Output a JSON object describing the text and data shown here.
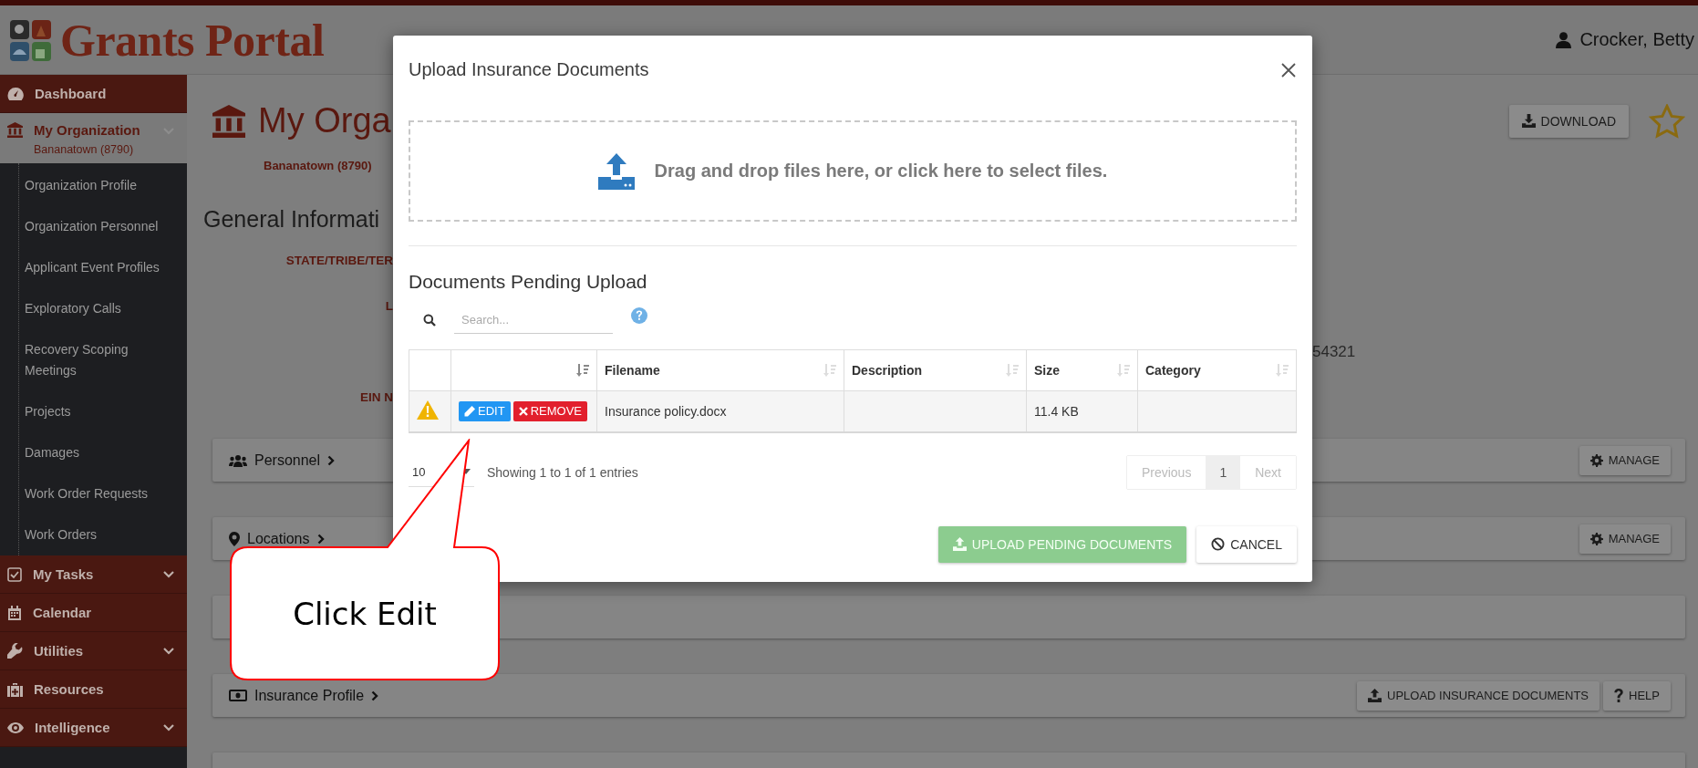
{
  "header": {
    "logo_text": "Grants Portal",
    "user": "Crocker, Betty"
  },
  "sidebar": {
    "items": [
      {
        "label": "Dashboard",
        "selected": false,
        "has_menu": false
      },
      {
        "label": "My Organization",
        "subtitle": "Bananatown (8790)",
        "selected": true,
        "has_menu": true,
        "children": [
          {
            "label": "Organization Profile",
            "selected": false
          },
          {
            "label": "Organization Personnel",
            "selected": false
          },
          {
            "label": "Applicant Event Profiles",
            "selected": false
          },
          {
            "label": "Exploratory Calls",
            "selected": false
          },
          {
            "label": "Recovery Scoping Meetings",
            "selected": false
          },
          {
            "label": "Projects",
            "selected": false
          },
          {
            "label": "Damages",
            "selected": false
          },
          {
            "label": "Work Order Requests",
            "selected": false
          },
          {
            "label": "Work Orders",
            "selected": false
          }
        ]
      },
      {
        "label": "My Tasks",
        "selected": false,
        "has_menu": true
      },
      {
        "label": "Calendar",
        "selected": false,
        "has_menu": false
      },
      {
        "label": "Utilities",
        "selected": false,
        "has_menu": true
      },
      {
        "label": "Resources",
        "selected": false,
        "has_menu": false
      },
      {
        "label": "Intelligence",
        "selected": false,
        "has_menu": true
      }
    ]
  },
  "main": {
    "title": "My Orga",
    "subtitle": "Bananatown (8790)",
    "download_button": "DOWNLOAD",
    "starred": false,
    "section_title": "General Informati",
    "fields": [
      {
        "label": "STATE/TRIBE/TER"
      },
      {
        "label": "L"
      },
      {
        "value": "54321"
      },
      {
        "label": "EIN N"
      }
    ],
    "panels": [
      {
        "kind": "titled",
        "title": "Personnel",
        "buttons": [
          {
            "label": "MANAGE",
            "kind": "manage"
          }
        ]
      },
      {
        "kind": "titled",
        "title": "Locations",
        "buttons": [
          {
            "label": "MANAGE",
            "kind": "manage"
          }
        ]
      },
      {
        "kind": "covered"
      },
      {
        "kind": "titled",
        "title": "Insurance Profile",
        "buttons": [
          {
            "label": "UPLOAD INSURANCE DOCUMENTS",
            "kind": "upload"
          },
          {
            "label": "HELP",
            "kind": "help"
          }
        ]
      },
      {
        "kind": "covered"
      }
    ]
  },
  "modal": {
    "title": "Upload Insurance Documents",
    "dropzone_text": "Drag and drop files here, or click here to select files.",
    "section_title": "Documents Pending Upload",
    "search": {
      "placeholder": "Search..."
    },
    "table": {
      "columns": [
        {
          "kind": "blank"
        },
        {
          "kind": "sort",
          "sorted": true
        },
        {
          "kind": "text",
          "label": "Filename",
          "sorted": false
        },
        {
          "kind": "text",
          "label": "Description",
          "sorted": false
        },
        {
          "kind": "text",
          "label": "Size",
          "sorted": false
        },
        {
          "kind": "text",
          "label": "Category",
          "sorted": false
        }
      ],
      "rows": [
        {
          "warning": true,
          "actions": [
            {
              "label": "EDIT",
              "kind": "edit"
            },
            {
              "label": "REMOVE",
              "kind": "remove"
            }
          ],
          "filename": "Insurance policy.docx",
          "size": "11.4 KB"
        }
      ]
    },
    "page_length": "10",
    "info": "Showing 1 to 1 of 1 entries",
    "pagination": [
      {
        "label": "Previous",
        "kind": "nav",
        "disabled": true,
        "selected": false
      },
      {
        "label": "1",
        "kind": "page",
        "disabled": false,
        "selected": true
      },
      {
        "label": "Next",
        "kind": "nav",
        "disabled": true,
        "selected": false
      }
    ],
    "buttons": [
      {
        "label": "UPLOAD PENDING DOCUMENTS",
        "kind": "upload",
        "disabled": true
      },
      {
        "label": "CANCEL",
        "kind": "cancel",
        "disabled": false
      }
    ]
  },
  "callout": {
    "text": "Click Edit"
  }
}
